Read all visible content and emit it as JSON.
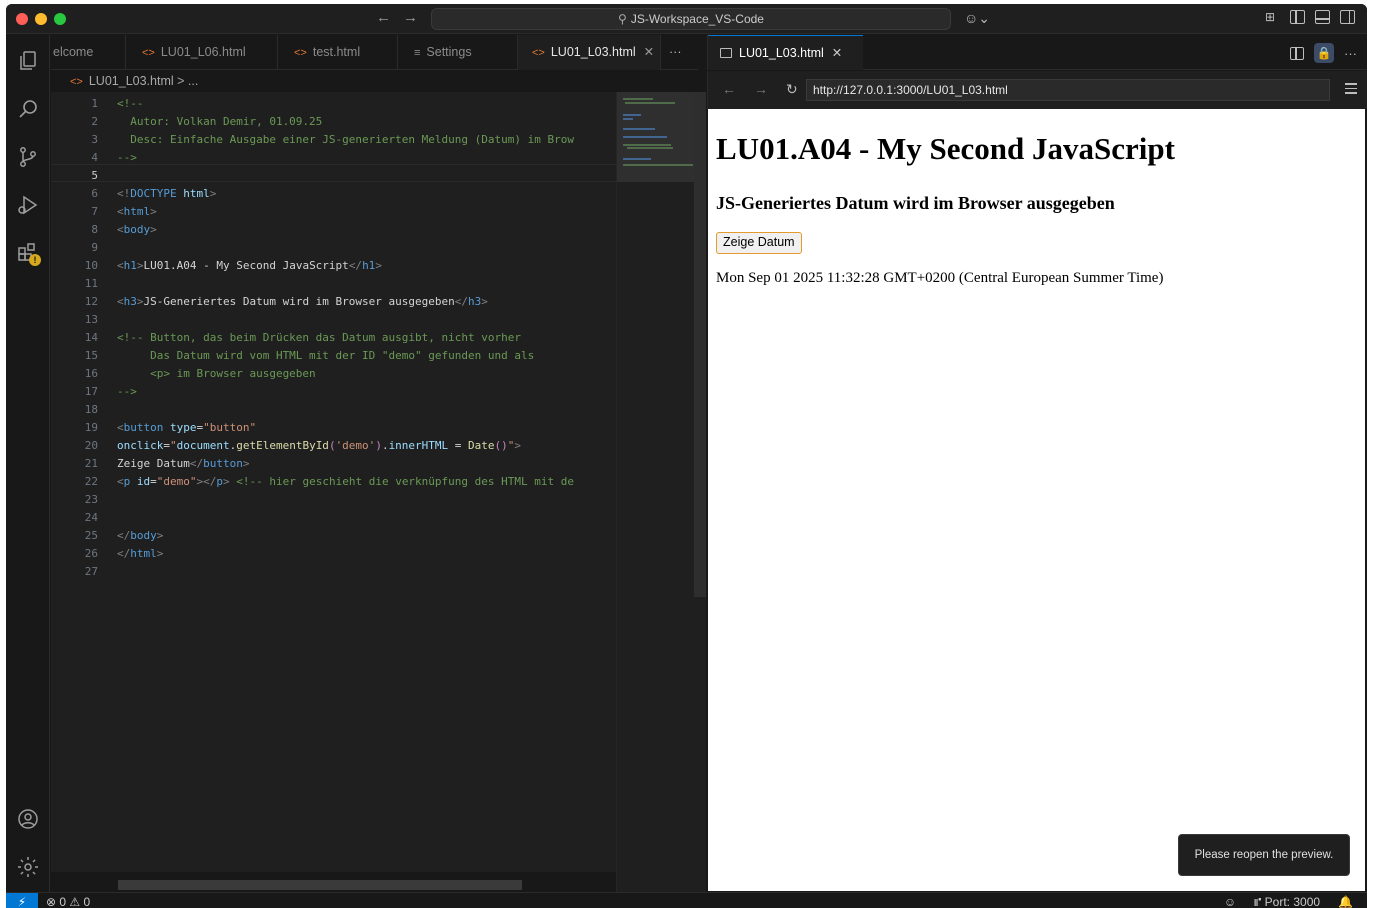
{
  "window": {
    "search_label": "JS-Workspace_VS-Code"
  },
  "editor": {
    "tabs": [
      {
        "label": "elcome",
        "icon": "none"
      },
      {
        "label": "LU01_L06.html",
        "icon": "html-file-icon"
      },
      {
        "label": "test.html",
        "icon": "html-file-icon"
      },
      {
        "label": "Settings",
        "icon": "settings-icon"
      },
      {
        "label": "LU01_L03.html",
        "icon": "html-file-icon",
        "active": true
      }
    ],
    "more_label": "···",
    "breadcrumb": "LU01_L03.html > ...",
    "current_line": 5,
    "lines": [
      "1",
      "2",
      "3",
      "4",
      "5",
      "6",
      "7",
      "8",
      "9",
      "10",
      "11",
      "12",
      "13",
      "14",
      "15",
      "16",
      "17",
      "18",
      "19",
      "20",
      "21",
      "22",
      "23",
      "24",
      "25",
      "26",
      "27"
    ]
  },
  "preview": {
    "tab_label": "LU01_L03.html",
    "url": "http://127.0.0.1:3000/LU01_L03.html",
    "h1": "LU01.A04 - My Second JavaScript",
    "h3": "JS-Generiertes Datum wird im Browser ausgegeben",
    "button_label": "Zeige Datum",
    "demo_text": "Mon Sep 01 2025 11:32:28 GMT+0200 (Central European Summer Time)",
    "toast": "Please reopen the preview."
  },
  "statusbar": {
    "problems": "⊗ 0 ⚠ 0",
    "port": "⑈ Port: 3000"
  },
  "colors": {
    "accent": "#0078d4",
    "tab_icon_html": "#e37933",
    "button_border": "#e49b2e"
  }
}
